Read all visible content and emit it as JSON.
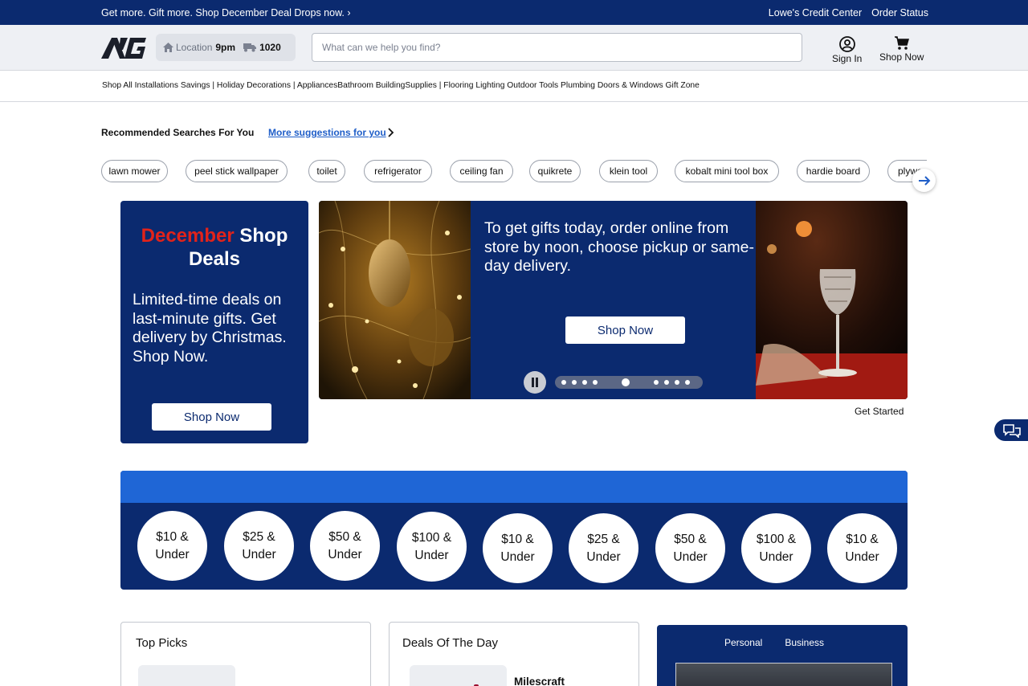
{
  "promo": {
    "text": "Get more. Gift more. Shop December Deal Drops now. ›",
    "links": [
      "Lowe's Credit Center",
      "Order Status"
    ]
  },
  "header": {
    "location_label": "Location",
    "location_time": "9pm",
    "delivery_zip": "1020",
    "search_placeholder": "What can we help you find?",
    "sign_in": "Sign In",
    "shop_now": "Shop Now"
  },
  "category_nav": "Shop All Installations Savings | Holiday Decorations | AppliancesBathroom BuildingSupplies | Flooring Lighting Outdoor Tools Plumbing Doors & Windows Gift Zone",
  "recommended": {
    "title": "Recommended Searches For You",
    "more_link": "More suggestions for you",
    "chips": [
      "lawn mower",
      "peel stick wallpaper",
      "toilet",
      "refrigerator",
      "ceiling fan",
      "quikrete",
      "klein tool",
      "kobalt mini tool box",
      "hardie board",
      "plywood"
    ]
  },
  "deal_card": {
    "title_red": "December",
    "title_rest": " Shop Deals",
    "body": "Limited-time deals on last-minute gifts. Get delivery by Christmas. Shop Now.",
    "button": "Shop Now"
  },
  "hero": {
    "text": "To get gifts today, order online from store by noon, choose pickup or same-day delivery.",
    "button": "Shop Now",
    "slides_total": 9,
    "slide_active": 5,
    "get_started": "Get Started"
  },
  "price_tiles": [
    {
      "amount": "$10 &",
      "label": "Under"
    },
    {
      "amount": "$25 &",
      "label": "Under"
    },
    {
      "amount": "$50 &",
      "label": "Under"
    },
    {
      "amount": "$100 &",
      "label": "Under"
    },
    {
      "amount": "$10 &",
      "label": "Under"
    },
    {
      "amount": "$25 &",
      "label": "Under"
    },
    {
      "amount": "$50 &",
      "label": "Under"
    },
    {
      "amount": "$100 &",
      "label": "Under"
    },
    {
      "amount": "$10 &",
      "label": "Under"
    }
  ],
  "cards": {
    "top_picks": "Top Picks",
    "deals_of_day": "Deals Of The Day",
    "deal_product": "Milescraft",
    "credit_tabs": [
      "Personal",
      "Business"
    ]
  },
  "colors": {
    "navy": "#0b2a6f",
    "blue": "#1f66d6",
    "red": "#e2231a"
  }
}
